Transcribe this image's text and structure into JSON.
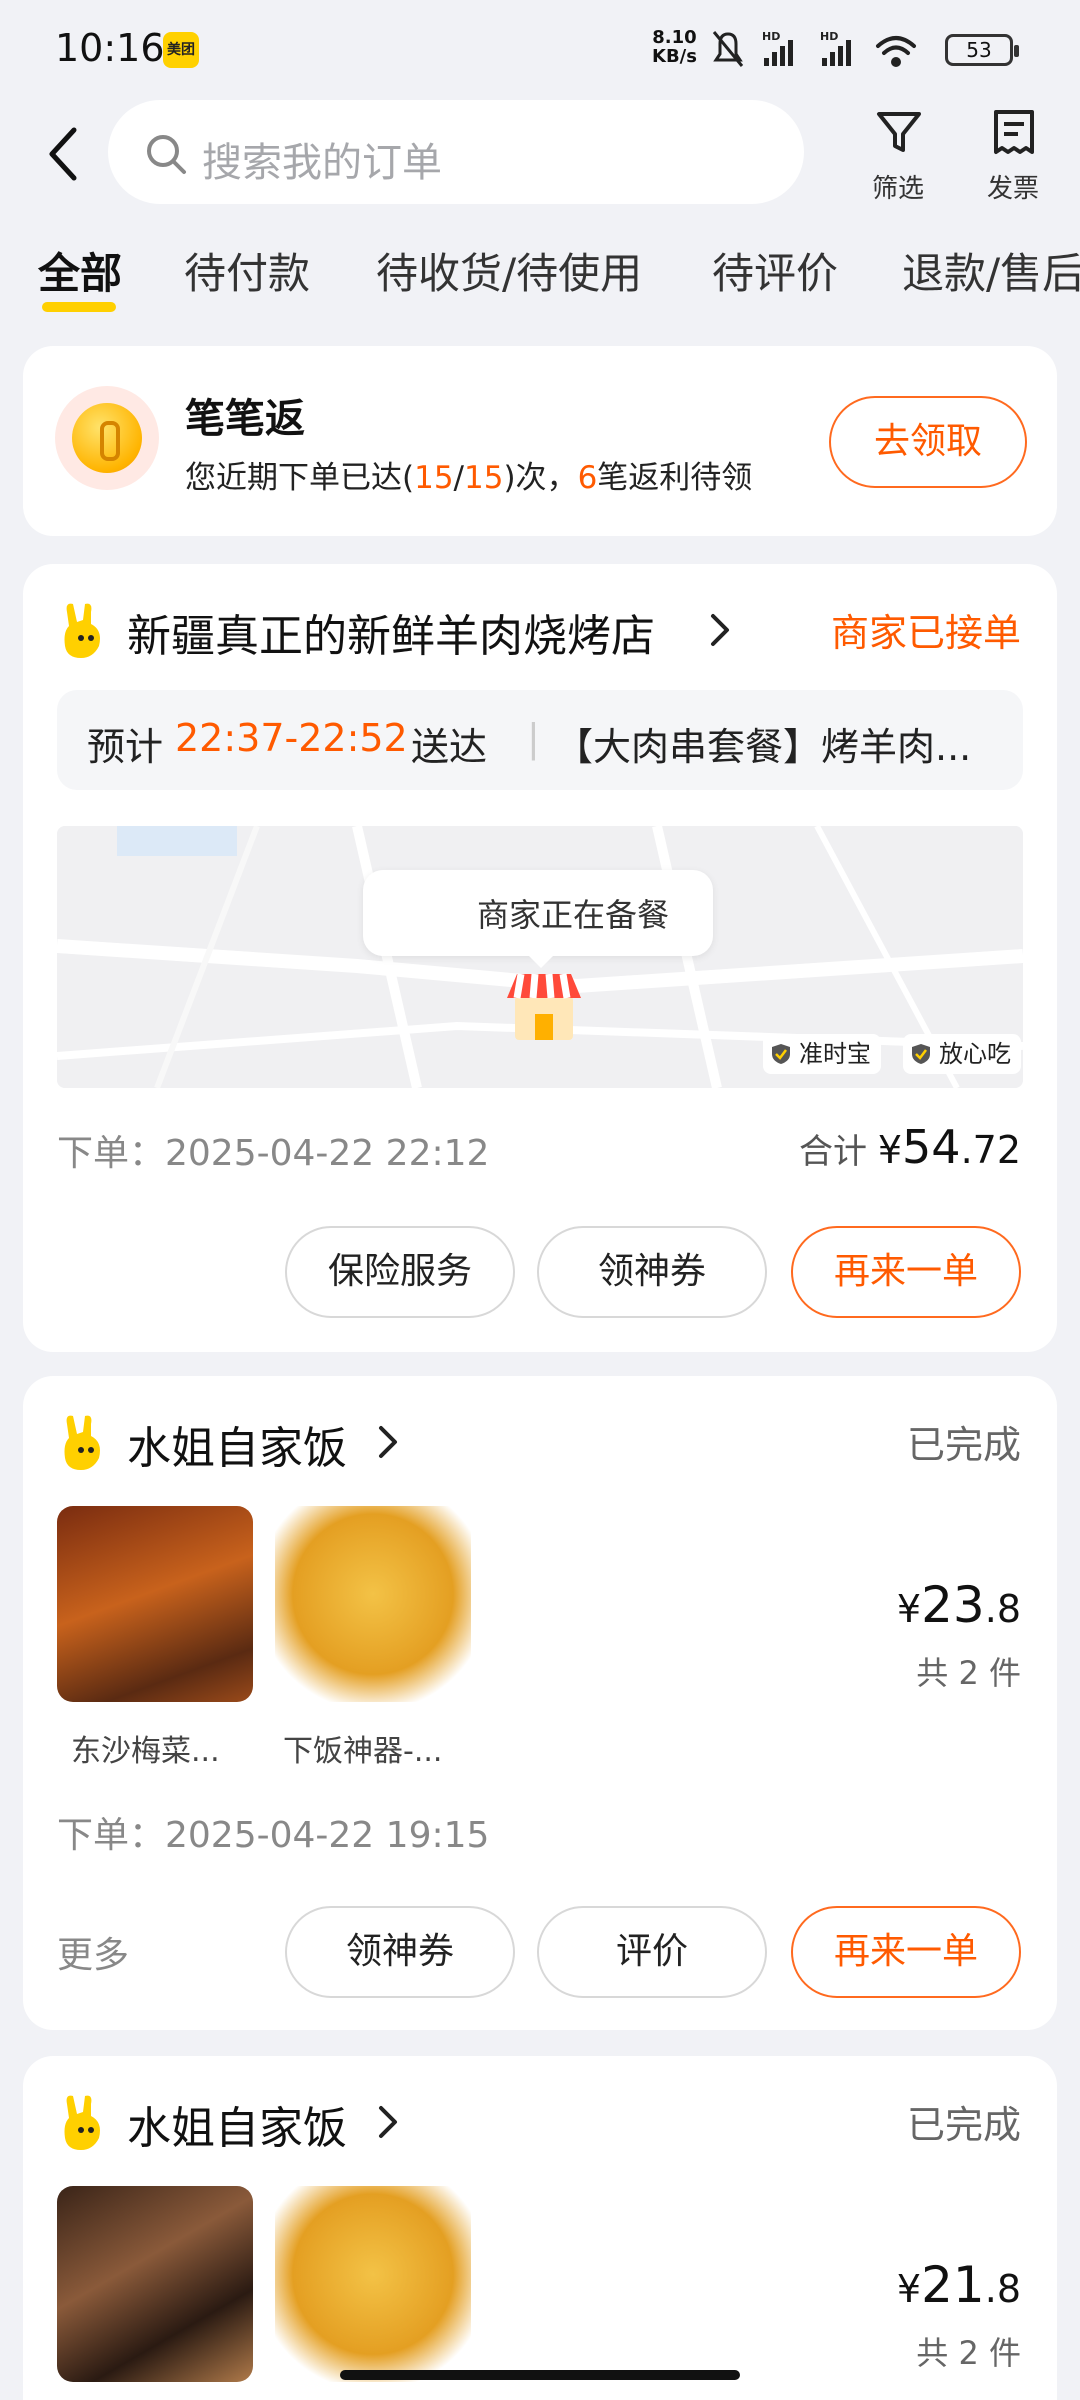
{
  "status_bar": {
    "time": "10:16",
    "app_badge": "美团",
    "net_speed": "8.10",
    "net_unit": "KB/s",
    "battery": "53"
  },
  "header": {
    "search_placeholder": "搜索我的订单",
    "filter_label": "筛选",
    "invoice_label": "发票"
  },
  "tabs": [
    "全部",
    "待付款",
    "待收货/待使用",
    "待评价",
    "退款/售后"
  ],
  "cashback": {
    "title": "笔笔返",
    "sub_prefix": "您近期下单已达(",
    "count_done": "15",
    "slash": "/",
    "count_total": "15",
    "sub_mid": ")次，",
    "pending": "6",
    "sub_suffix": "笔返利待领",
    "button": "去领取"
  },
  "orders": [
    {
      "shop": "新疆真正的新鲜羊肉烧烤店",
      "status": "商家已接单",
      "eta_prefix": "预计",
      "eta_time": "22:37-22:52",
      "eta_suffix": "送达",
      "eta_items": "【大肉串套餐】烤羊肉...",
      "map_bubble": "商家正在备餐",
      "map_tags": [
        "准时宝",
        "放心吃"
      ],
      "order_time": "下单：2025-04-22 22:12",
      "total_label": "合计",
      "total_cur": "¥",
      "total_int": "54",
      "total_dec": ".72",
      "buttons": [
        "保险服务",
        "领神券",
        "再来一单"
      ]
    },
    {
      "shop": "水姐自家饭",
      "status": "已完成",
      "items": [
        "东沙梅菜...",
        "下饭神器-..."
      ],
      "price_cur": "¥",
      "price_int": "23",
      "price_dec": ".8",
      "qty": "共 2 件",
      "order_time": "下单：2025-04-22 19:15",
      "more": "更多",
      "buttons": [
        "领神券",
        "评价",
        "再来一单"
      ]
    },
    {
      "shop": "水姐自家饭",
      "status": "已完成",
      "price_cur": "¥",
      "price_int": "21",
      "price_dec": ".8",
      "qty": "共 2 件"
    }
  ],
  "colors": {
    "accent_orange": "#ff5a00",
    "brand_yellow": "#ffd000",
    "background": "#f1f2f6"
  }
}
